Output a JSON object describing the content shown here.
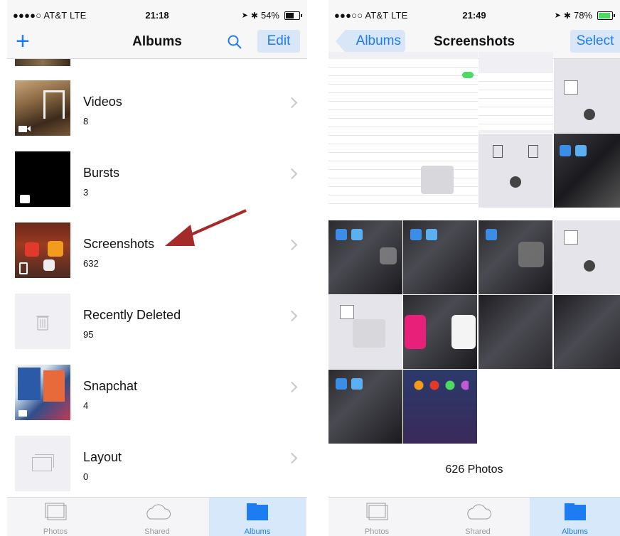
{
  "left": {
    "status": {
      "carrier": "●●●●○ AT&T  LTE",
      "time": "21:18",
      "battery": "54%",
      "battery_level": 0.54
    },
    "nav": {
      "title": "Albums",
      "edit_label": "Edit",
      "plus_label": "+"
    },
    "albums": [
      {
        "name": "Videos",
        "count": "8"
      },
      {
        "name": "Bursts",
        "count": "3"
      },
      {
        "name": "Screenshots",
        "count": "632"
      },
      {
        "name": "Recently Deleted",
        "count": "95"
      },
      {
        "name": "Snapchat",
        "count": "4"
      },
      {
        "name": "Layout",
        "count": "0"
      }
    ],
    "tabs": [
      {
        "label": "Photos",
        "icon": "photos-icon"
      },
      {
        "label": "Shared",
        "icon": "cloud-icon"
      },
      {
        "label": "Albums",
        "icon": "folder-icon"
      }
    ]
  },
  "right": {
    "status": {
      "carrier": "●●●○○ AT&T  LTE",
      "time": "21:49",
      "battery": "78%",
      "battery_level": 0.78
    },
    "nav": {
      "back_label": "Albums",
      "title": "Screenshots",
      "select_label": "Select"
    },
    "photos_count": "626 Photos",
    "tabs": [
      {
        "label": "Photos",
        "icon": "photos-icon"
      },
      {
        "label": "Shared",
        "icon": "cloud-icon"
      },
      {
        "label": "Albums",
        "icon": "folder-icon"
      }
    ]
  },
  "colors": {
    "accent": "#1e7cf2",
    "arrow": "#a52a2a",
    "tab_active_bg": "#d7e8fb"
  }
}
